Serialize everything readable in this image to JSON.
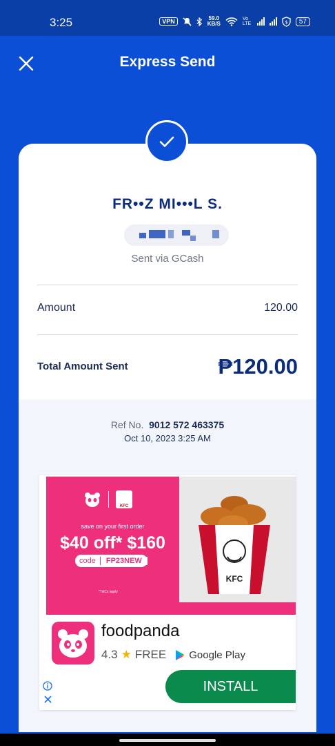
{
  "status_bar": {
    "time": "3:25",
    "vpn": "VPN",
    "speed_value": "59.0",
    "speed_unit": "KB/S",
    "network": "Vo LTE",
    "battery": "57"
  },
  "header": {
    "title": "Express Send"
  },
  "receipt": {
    "recipient_name": "FR••Z MI•••L S.",
    "sent_via": "Sent via GCash",
    "amount_label": "Amount",
    "amount_value": "120.00",
    "total_label": "Total Amount Sent",
    "total_value": "₱120.00",
    "ref_label": "Ref No.",
    "ref_number": "9012 572 463375",
    "datetime": "Oct 10, 2023 3:25 AM"
  },
  "ad": {
    "promo_line": "save on your first order",
    "promo_headline": "$40 off* $160",
    "code_label": "code",
    "code_value": "FP23NEW",
    "tc_note": "*T&Cs apply",
    "kfc_label": "KFC",
    "app_name": "foodpanda",
    "rating": "4.3",
    "price": "FREE",
    "store": "Google Play",
    "install_label": "INSTALL"
  },
  "colors": {
    "primary_blue": "#0a4fd6",
    "status_bar": "#0b3fa8",
    "navy_text": "#0b2c7a",
    "ad_pink": "#ee2f7c",
    "install_green": "#0a8a4c"
  }
}
